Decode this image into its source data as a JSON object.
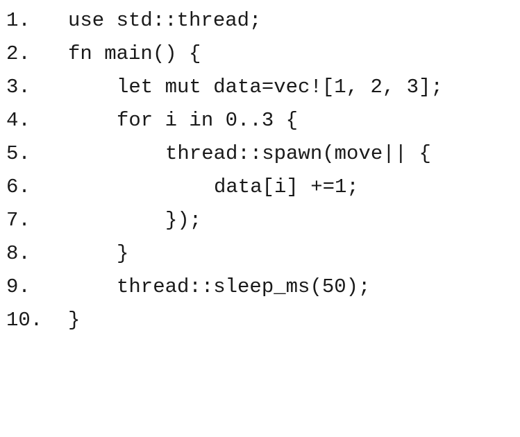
{
  "code_listing": {
    "lines": [
      {
        "number": "1.",
        "code": "use std::thread;"
      },
      {
        "number": "2.",
        "code": "fn main() {"
      },
      {
        "number": "3.",
        "code": "let mut data=vec![1, 2, 3];"
      },
      {
        "number": "4.",
        "code": "for i in 0..3 {"
      },
      {
        "number": "5.",
        "code": "thread::spawn(move|| {"
      },
      {
        "number": "6.",
        "code": "data[i] +=1;"
      },
      {
        "number": "7.",
        "code": "});"
      },
      {
        "number": "8.",
        "code": "}"
      },
      {
        "number": "9.",
        "code": "thread::sleep_ms(50);"
      },
      {
        "number": "10.",
        "code": "}"
      }
    ]
  }
}
